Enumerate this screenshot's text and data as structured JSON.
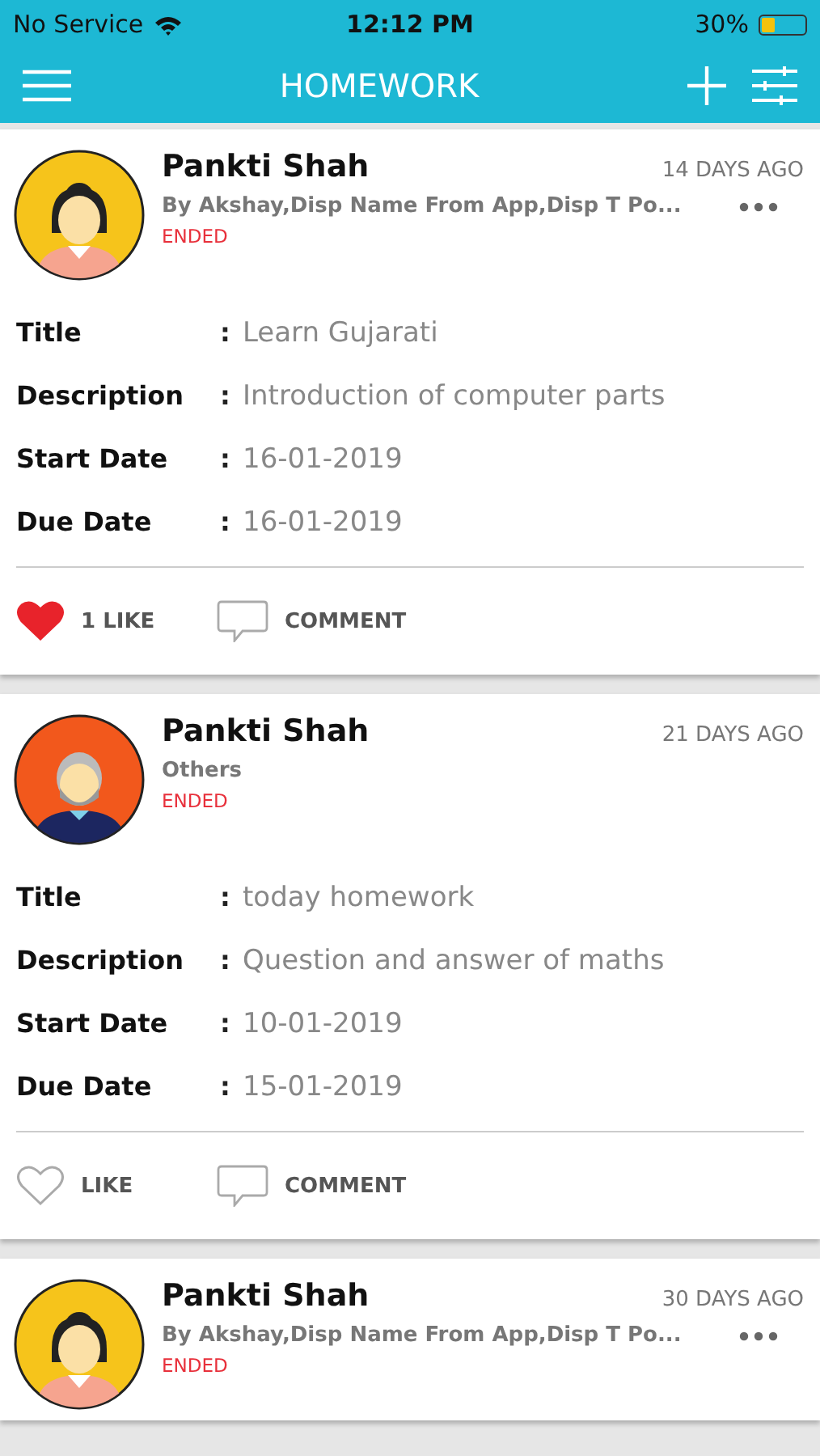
{
  "status_bar": {
    "carrier": "No Service",
    "time": "12:12 PM",
    "battery": "30%"
  },
  "nav": {
    "title": "HOMEWORK"
  },
  "cards": [
    {
      "author": "Pankti Shah",
      "subtitle": "By Akshay,Disp Name From App,Disp T Po...",
      "status": "ENDED",
      "time_ago": "14 DAYS AGO",
      "menu": true,
      "avatar": {
        "kind": "woman",
        "color": "#f6c41b"
      },
      "fields": [
        {
          "label": "Title",
          "sep": ":",
          "value": "Learn Gujarati"
        },
        {
          "label": "Description",
          "sep": ":",
          "value": "Introduction of computer parts"
        },
        {
          "label": "Start Date",
          "sep": ":",
          "value": "16-01-2019"
        },
        {
          "label": "Due Date",
          "sep": ":",
          "value": "16-01-2019"
        }
      ],
      "like": {
        "label": "1 LIKE",
        "liked": true
      },
      "comment": "COMMENT"
    },
    {
      "author": "Pankti Shah",
      "subtitle": "Others",
      "status": "ENDED",
      "time_ago": "21 DAYS AGO",
      "menu": false,
      "avatar": {
        "kind": "man",
        "color": "#f2581c"
      },
      "fields": [
        {
          "label": "Title",
          "sep": ":",
          "value": "today homework"
        },
        {
          "label": "Description",
          "sep": ":",
          "value": "Question and answer of maths"
        },
        {
          "label": "Start Date",
          "sep": ":",
          "value": "10-01-2019"
        },
        {
          "label": "Due Date",
          "sep": ":",
          "value": "15-01-2019"
        }
      ],
      "like": {
        "label": "LIKE",
        "liked": false
      },
      "comment": "COMMENT"
    },
    {
      "author": "Pankti Shah",
      "subtitle": "By Akshay,Disp Name From App,Disp T Po...",
      "status": "ENDED",
      "time_ago": "30 DAYS AGO",
      "menu": true,
      "avatar": {
        "kind": "woman",
        "color": "#f6c41b"
      }
    }
  ]
}
